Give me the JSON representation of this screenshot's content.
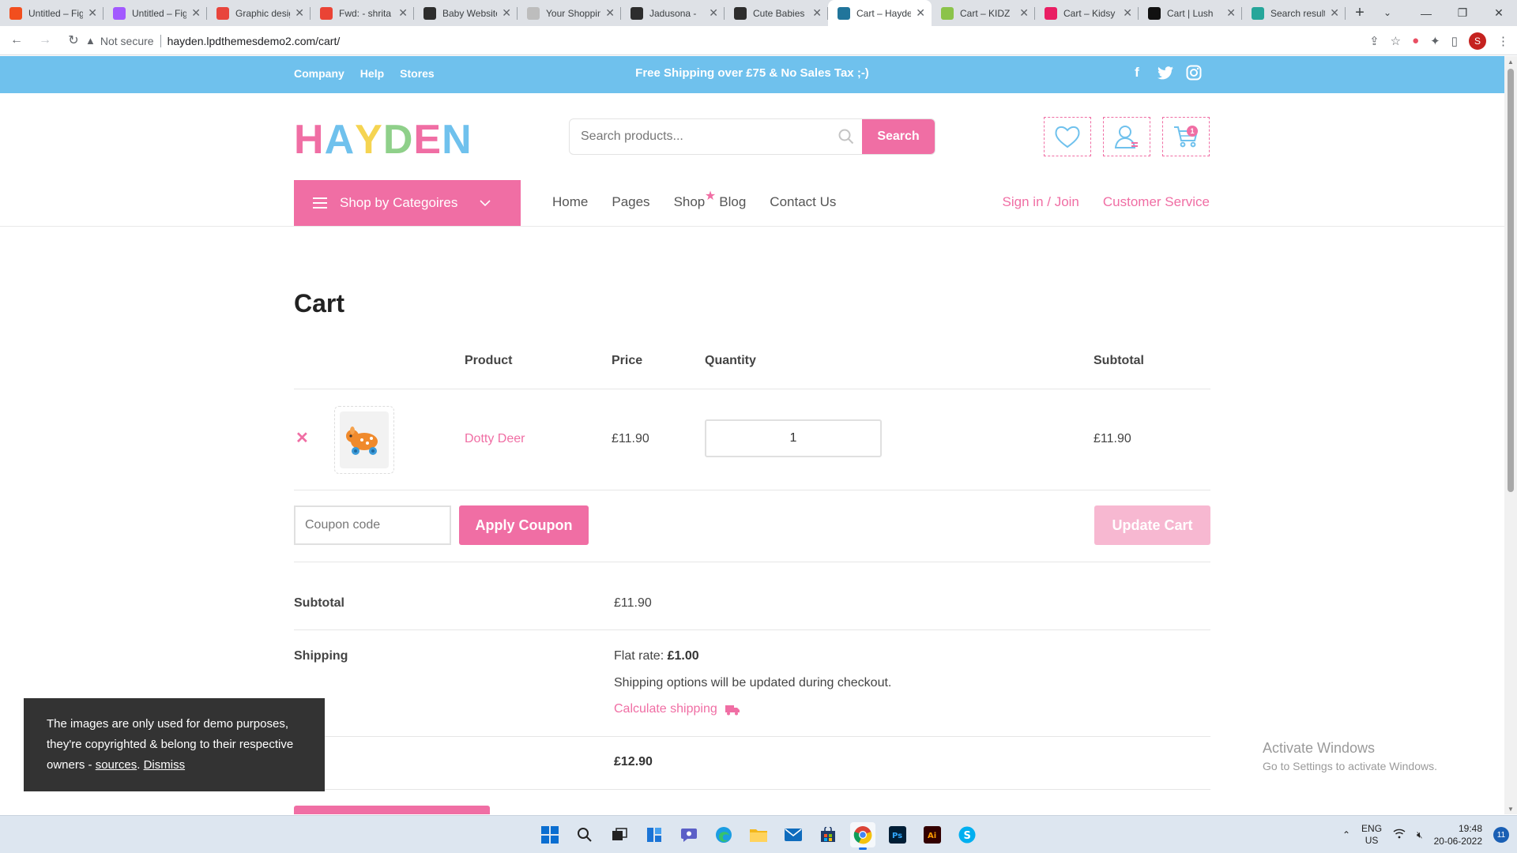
{
  "browser": {
    "tabs": [
      {
        "label": "Untitled – Figma",
        "color": "#f24e1e"
      },
      {
        "label": "Untitled – Figma",
        "color": "#a259ff"
      },
      {
        "label": "Graphic design",
        "color": "#e8453c"
      },
      {
        "label": "Fwd: - shrita",
        "color": "#ea4335"
      },
      {
        "label": "Baby Website",
        "color": "#2d2d2d"
      },
      {
        "label": "Your Shopping",
        "color": "#bdbdbd"
      },
      {
        "label": "Jadusona -",
        "color": "#2d2d2d"
      },
      {
        "label": "Cute Babies",
        "color": "#2d2d2d"
      },
      {
        "label": "Cart – Hayden",
        "color": "#21759b"
      },
      {
        "label": "Cart – KIDZ",
        "color": "#8bc34a"
      },
      {
        "label": "Cart – Kidsy",
        "color": "#e91e63"
      },
      {
        "label": "Cart | Lush",
        "color": "#111111"
      },
      {
        "label": "Search results",
        "color": "#26a69a"
      }
    ],
    "active_tab_index": 8,
    "security_label": "Not secure",
    "url": "hayden.lpdthemesdemo2.com/cart/",
    "profile_initial": "S"
  },
  "topbar": {
    "links": [
      "Company",
      "Help",
      "Stores"
    ],
    "promo": "Free Shipping over £75 & No Sales Tax ;-)",
    "social": [
      "facebook-icon",
      "twitter-icon",
      "instagram-icon"
    ]
  },
  "header": {
    "logo_letters": [
      {
        "char": "H",
        "color": "#f06ea4"
      },
      {
        "char": "A",
        "color": "#6fc1ed"
      },
      {
        "char": "Y",
        "color": "#f5d451"
      },
      {
        "char": "D",
        "color": "#8fd08a"
      },
      {
        "char": "E",
        "color": "#f06ea4"
      },
      {
        "char": "N",
        "color": "#6fc1ed"
      }
    ],
    "search_placeholder": "Search products...",
    "search_button": "Search",
    "cart_count": "1"
  },
  "nav": {
    "categories_label": "Shop by Categoires",
    "items": [
      "Home",
      "Pages",
      "Shop",
      "Blog",
      "Contact Us"
    ],
    "right": [
      "Sign in / Join",
      "Customer Service"
    ]
  },
  "cart": {
    "title": "Cart",
    "columns": {
      "product": "Product",
      "price": "Price",
      "quantity": "Quantity",
      "subtotal": "Subtotal"
    },
    "items": [
      {
        "name": "Dotty Deer",
        "price": "£11.90",
        "quantity": "1",
        "subtotal": "£11.90"
      }
    ],
    "coupon_placeholder": "Coupon code",
    "apply_coupon": "Apply Coupon",
    "update_cart": "Update Cart"
  },
  "totals": {
    "subtotal_label": "Subtotal",
    "subtotal_value": "£11.90",
    "shipping_label": "Shipping",
    "flat_rate_label": "Flat rate:",
    "flat_rate_value": "£1.00",
    "shipping_note": "Shipping options will be updated during checkout.",
    "calculate_shipping": "Calculate shipping",
    "total_label_partial": "AL",
    "total_value": "£12.90"
  },
  "cookie": {
    "text": "The images are only used for demo purposes, they're copyrighted & belong to their respective owners -",
    "sources": "sources",
    "dismiss": "Dismiss"
  },
  "watermark": {
    "line1": "Activate Windows",
    "line2": "Go to Settings to activate Windows."
  },
  "taskbar": {
    "apps": [
      "windows-start-icon",
      "search-icon",
      "task-view-icon",
      "widgets-icon",
      "teams-chat-icon",
      "edge-icon",
      "file-explorer-icon",
      "mail-icon",
      "store-icon",
      "chrome-icon",
      "photoshop-icon",
      "illustrator-icon",
      "skype-icon"
    ],
    "lang_1": "ENG",
    "lang_2": "US",
    "time": "19:48",
    "date": "20-06-2022",
    "notifications": "11"
  },
  "colors": {
    "accent_pink": "#f06ea4",
    "topbar_blue": "#6fc1ed"
  }
}
